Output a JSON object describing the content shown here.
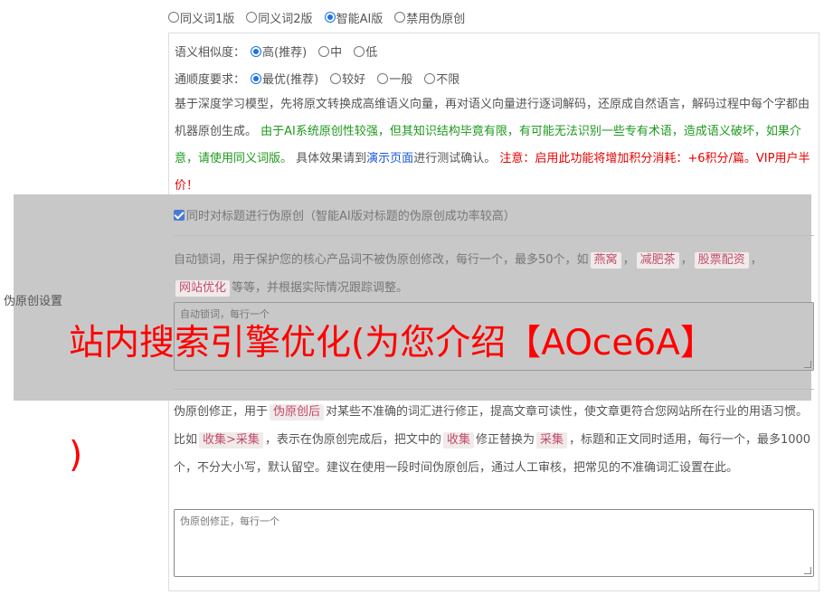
{
  "mode_options": [
    {
      "label": "同义词1版",
      "checked": false
    },
    {
      "label": "同义词2版",
      "checked": false
    },
    {
      "label": "智能AI版",
      "checked": true
    },
    {
      "label": "禁用伪原创",
      "checked": false
    }
  ],
  "similarity": {
    "label": "语义相似度：",
    "options": [
      {
        "label": "高(推荐)",
        "checked": true
      },
      {
        "label": "中",
        "checked": false
      },
      {
        "label": "低",
        "checked": false
      }
    ]
  },
  "fluency": {
    "label": "通顺度要求：",
    "options": [
      {
        "label": "最优(推荐)",
        "checked": true
      },
      {
        "label": "较好",
        "checked": false
      },
      {
        "label": "一般",
        "checked": false
      },
      {
        "label": "不限",
        "checked": false
      }
    ]
  },
  "ai_desc": {
    "part1": "基于深度学习模型，先将原文转换成高维语义向量，再对语义向量进行逐词解码，还原成自然语言，解码过程中每个字都由机器原创生成。",
    "part2_green": "由于AI系统原创性较强，但其知识结构毕竟有限，有可能无法识别一些专有术语，造成语义破坏，如果介意，请使用同义词版。",
    "part3": "具体效果请到",
    "link": "演示页面",
    "part4": "进行测试确认。",
    "part5_red": "注意：启用此功能将增加积分消耗：+6积分/篇。VIP用户半价！"
  },
  "side_label": "伪原创设置",
  "title_checkbox": {
    "label": "同时对标题进行伪原创（智能AI版对标题的伪原创成功率较高）",
    "checked": true
  },
  "lock_desc": {
    "part1": "自动锁词，用于保护您的核心产品词不被伪原创修改，每行一个，最多50个，如",
    "tags": [
      "燕窝",
      "减肥茶",
      "股票配资",
      "网站优化"
    ],
    "part2": "等等，并根据实际情况跟踪调整。",
    "placeholder": "自动锁词，每行一个"
  },
  "fix_desc": {
    "part1": "伪原创修正，用于",
    "tag1": "伪原创后",
    "part2": "对某些不准确的词汇进行修正，提高文章可读性，使文章更符合您网站所在行业的用语习惯。比如",
    "tag2": "收集>采集",
    "part3": "，表示在伪原创完成后，把文中的",
    "tag3": "收集",
    "part4": "修正替换为",
    "tag4": "采集",
    "part5": "，标题和正文同时适用，每行一个，最多1000个，不分大小写，默认留空。建议在使用一段时间伪原创后，通过人工审核，把常见的不准确词汇设置在此。",
    "placeholder": "伪原创修正，每行一个"
  },
  "banner": {
    "line1": "站内搜索引擎优化(为您介绍【AOce6A】",
    "line2": ")"
  }
}
